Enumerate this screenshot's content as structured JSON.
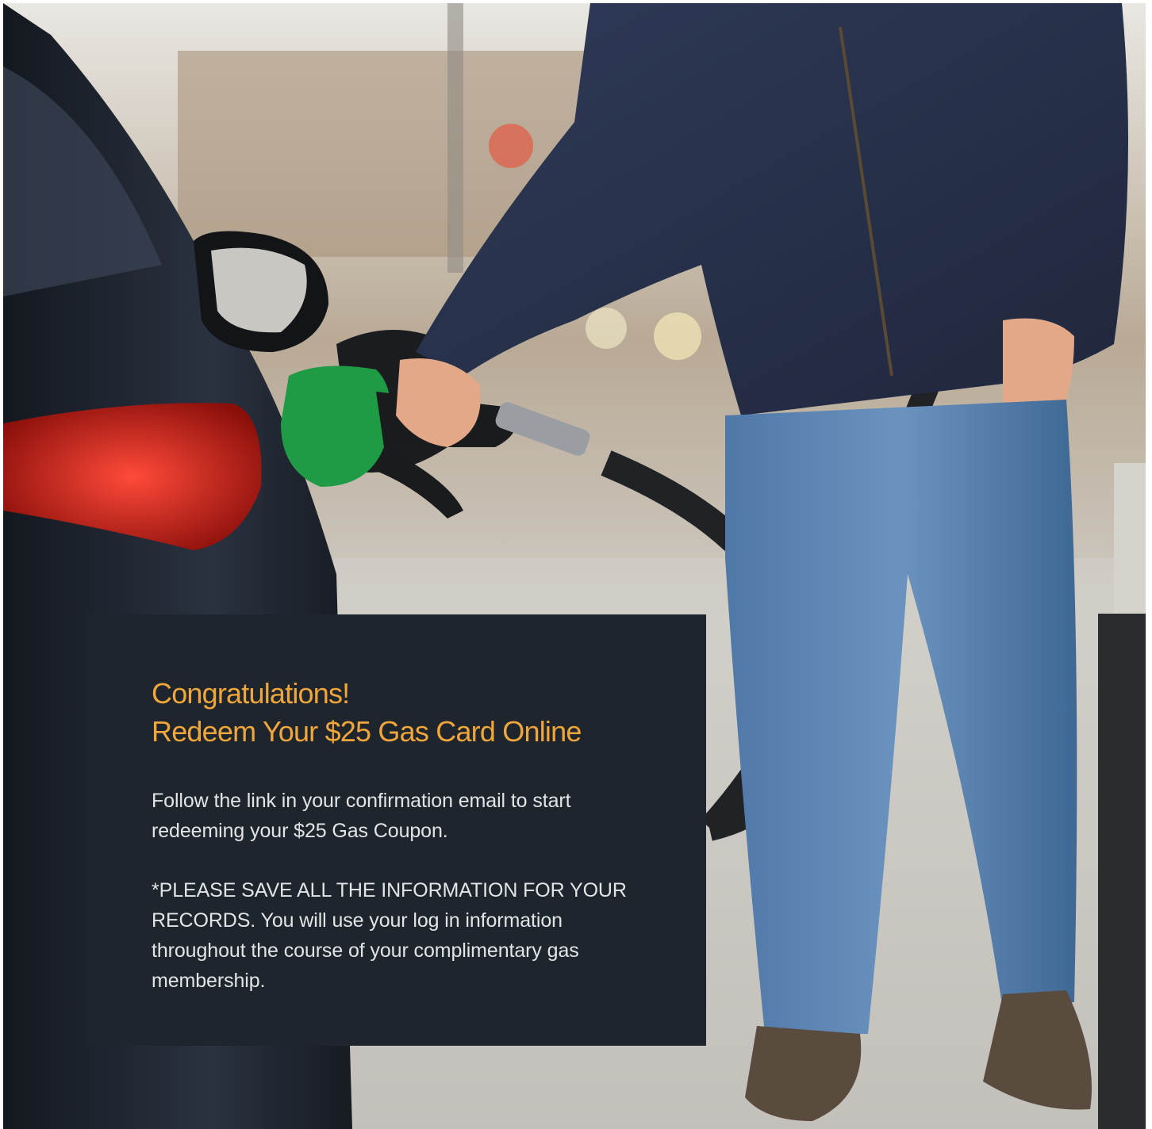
{
  "hero": {
    "image_icon": "fuel-pump-photo"
  },
  "card": {
    "title_line1": "Congratulations!",
    "title_line2": "Redeem Your $25 Gas Card Online",
    "paragraph1": "Follow the link in your confirmation email to start redeeming your $25 Gas Coupon.",
    "paragraph2": "*PLEASE SAVE ALL THE INFORMATION FOR YOUR RECORDS. You will use your log in information throughout the course of your complimentary gas membership.",
    "background_color": "#1f252c",
    "accent_color": "#f0a63a"
  }
}
